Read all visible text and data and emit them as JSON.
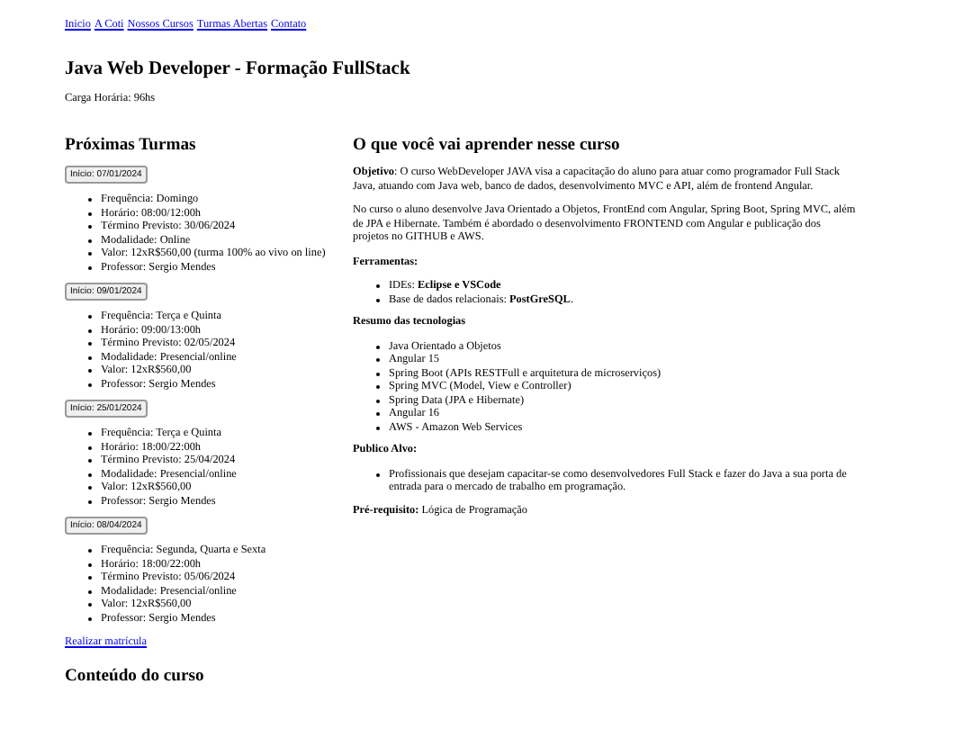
{
  "nav": [
    "Inicio",
    "A Coti",
    "Nossos Cursos",
    "Turmas Abertas",
    "Contato"
  ],
  "title": "Java Web Developer - Formação FullStack",
  "workload": "Carga Horária: 96hs",
  "classes_heading": "Próximas Turmas",
  "classes": [
    {
      "start": "Início: 07/01/2024",
      "details": [
        "Frequência: Domingo",
        "Horário: 08:00/12:00h",
        "Término Previsto: 30/06/2024",
        "Modalidade: Online",
        "Valor: 12xR$560,00 (turma 100% ao vivo on line)",
        "Professor: Sergio Mendes"
      ]
    },
    {
      "start": "Início: 09/01/2024",
      "details": [
        "Frequência: Terça e Quinta",
        "Horário: 09:00/13:00h",
        "Término Previsto: 02/05/2024",
        "Modalidade: Presencial/online",
        "Valor: 12xR$560,00",
        "Professor: Sergio Mendes"
      ]
    },
    {
      "start": "Início: 25/01/2024",
      "details": [
        "Frequência: Terça e Quinta",
        "Horário: 18:00/22:00h",
        "Término Previsto: 25/04/2024",
        "Modalidade: Presencial/online",
        "Valor: 12xR$560,00",
        "Professor: Sergio Mendes"
      ]
    },
    {
      "start": "Início: 08/04/2024",
      "details": [
        "Frequência: Segunda, Quarta e Sexta",
        "Horário: 18:00/22:00h",
        "Término Previsto: 05/06/2024",
        "Modalidade: Presencial/online",
        "Valor: 12xR$560,00",
        "Professor: Sergio Mendes"
      ]
    }
  ],
  "enroll_link": "Realizar matrícula",
  "content_heading": "Conteúdo do curso",
  "learn_heading": "O que você vai aprender nesse curso",
  "paragraphs": [
    "**Objetivo**: O curso WebDeveloper JAVA visa a capacitação do aluno para atuar como programador Full Stack Java, atuando com Java web, banco de dados, desenvolvimento MVC e API, além de frontend Angular.",
    "No curso o aluno desenvolve Java Orientado a Objetos, FrontEnd com Angular, Spring Boot, Spring MVC, além de JPA e Hibernate. Também é abordado o desenvolvimento FRONTEND com Angular e publicação dos projetos no GITHUB e AWS."
  ],
  "sections": [
    {
      "heading": "Ferramentas:",
      "items": [
        "IDEs: **Eclipse e VSCode**",
        "Base de dados relacionais: **PostGreSQL**."
      ]
    },
    {
      "heading": "Resumo das tecnologias",
      "items": [
        "Java Orientado a Objetos",
        "Angular 15",
        "Spring Boot (APIs RESTFull e arquitetura de microserviços)",
        "Spring MVC (Model, View e Controller)",
        "Spring Data (JPA e Hibernate)",
        "Angular 16",
        "AWS - Amazon Web Services"
      ]
    },
    {
      "heading": "Publico Alvo:",
      "items": [
        "Profissionais que desejam capacitar-se como desenvolvedores Full Stack e fazer do Java a sua porta de entrada para o mercado de trabalho em programação."
      ]
    }
  ],
  "prerequisite": "**Pré-requisito:** Lógica de Programação"
}
